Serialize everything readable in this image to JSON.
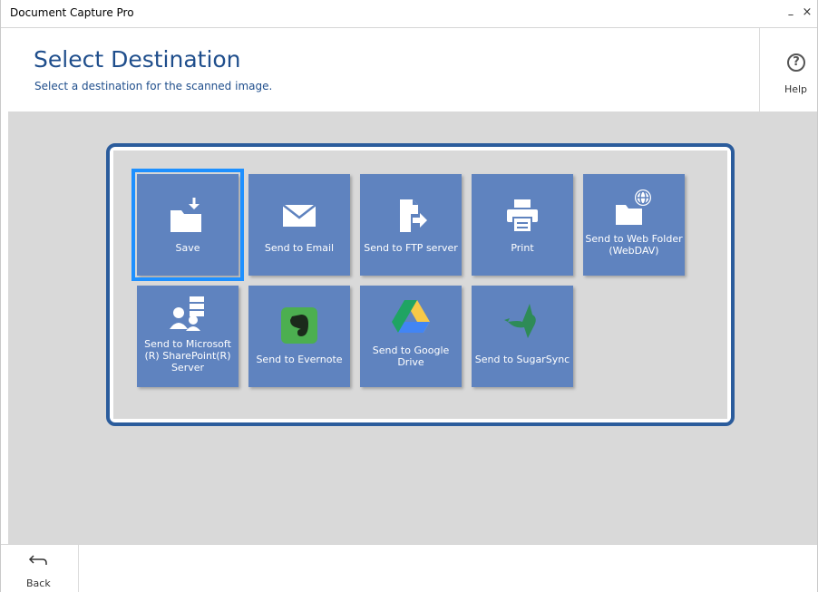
{
  "window": {
    "title": "Document Capture Pro",
    "minimize": "–",
    "close": "×"
  },
  "header": {
    "title": "Select Destination",
    "subtitle": "Select a destination for the scanned image."
  },
  "help": {
    "label": "Help",
    "icon": "question-circle-icon"
  },
  "footer": {
    "back_label": "Back",
    "back_icon": "back-arrow-icon"
  },
  "colors": {
    "accent": "#1f4e8c",
    "tile": "#5f83bf",
    "frame": "#2b5c9c",
    "selection": "#1e90ff",
    "background": "#d9d9d9"
  },
  "destinations": [
    {
      "label": "Save",
      "icon": "folder-download-icon",
      "selected": true
    },
    {
      "label": "Send to Email",
      "icon": "envelope-icon",
      "selected": false
    },
    {
      "label": "Send to FTP server",
      "icon": "file-arrow-icon",
      "selected": false
    },
    {
      "label": "Print",
      "icon": "printer-icon",
      "selected": false
    },
    {
      "label": "Send to Web Folder (WebDAV)",
      "icon": "folder-globe-icon",
      "selected": false
    },
    {
      "label": "Send to Microsoft (R) SharePoint(R) Server",
      "icon": "sharepoint-icon",
      "selected": false
    },
    {
      "label": "Send to Evernote",
      "icon": "evernote-icon",
      "selected": false
    },
    {
      "label": "Send to Google Drive",
      "icon": "google-drive-icon",
      "selected": false
    },
    {
      "label": "Send to SugarSync",
      "icon": "sugarsync-icon",
      "selected": false
    }
  ]
}
